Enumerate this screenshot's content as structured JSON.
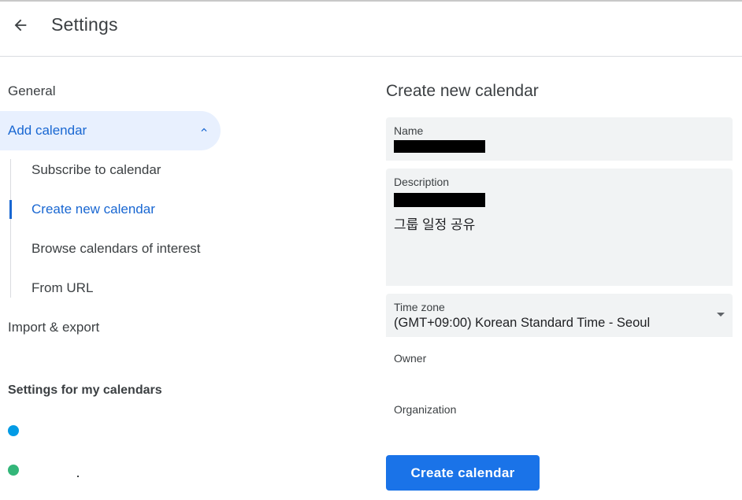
{
  "header": {
    "title": "Settings"
  },
  "sidebar": {
    "items": [
      {
        "label": "General"
      },
      {
        "label": "Add calendar"
      },
      {
        "label": "Import & export"
      }
    ],
    "add_calendar_sub": [
      {
        "label": "Subscribe to calendar"
      },
      {
        "label": "Create new calendar"
      },
      {
        "label": "Browse calendars of interest"
      },
      {
        "label": "From URL"
      }
    ],
    "section_title": "Settings for my calendars",
    "my_calendars": [
      {
        "color": "#039be5"
      },
      {
        "color": "#33b679"
      }
    ]
  },
  "main": {
    "title": "Create new calendar",
    "name_field": {
      "label": "Name"
    },
    "description_field": {
      "label": "Description",
      "visible_line": "그룹 일정 공유"
    },
    "timezone_field": {
      "label": "Time zone",
      "value": "(GMT+09:00) Korean Standard Time - Seoul"
    },
    "owner_label": "Owner",
    "organization_label": "Organization",
    "create_button": "Create calendar"
  },
  "colors": {
    "accent": "#1a73e8",
    "active_text": "#1967d2",
    "active_bg": "#e8f0fe",
    "field_bg": "#f1f3f4"
  },
  "icons": {
    "back": "arrow-left-icon",
    "collapse": "chevron-up-icon",
    "dropdown": "caret-down-icon"
  }
}
